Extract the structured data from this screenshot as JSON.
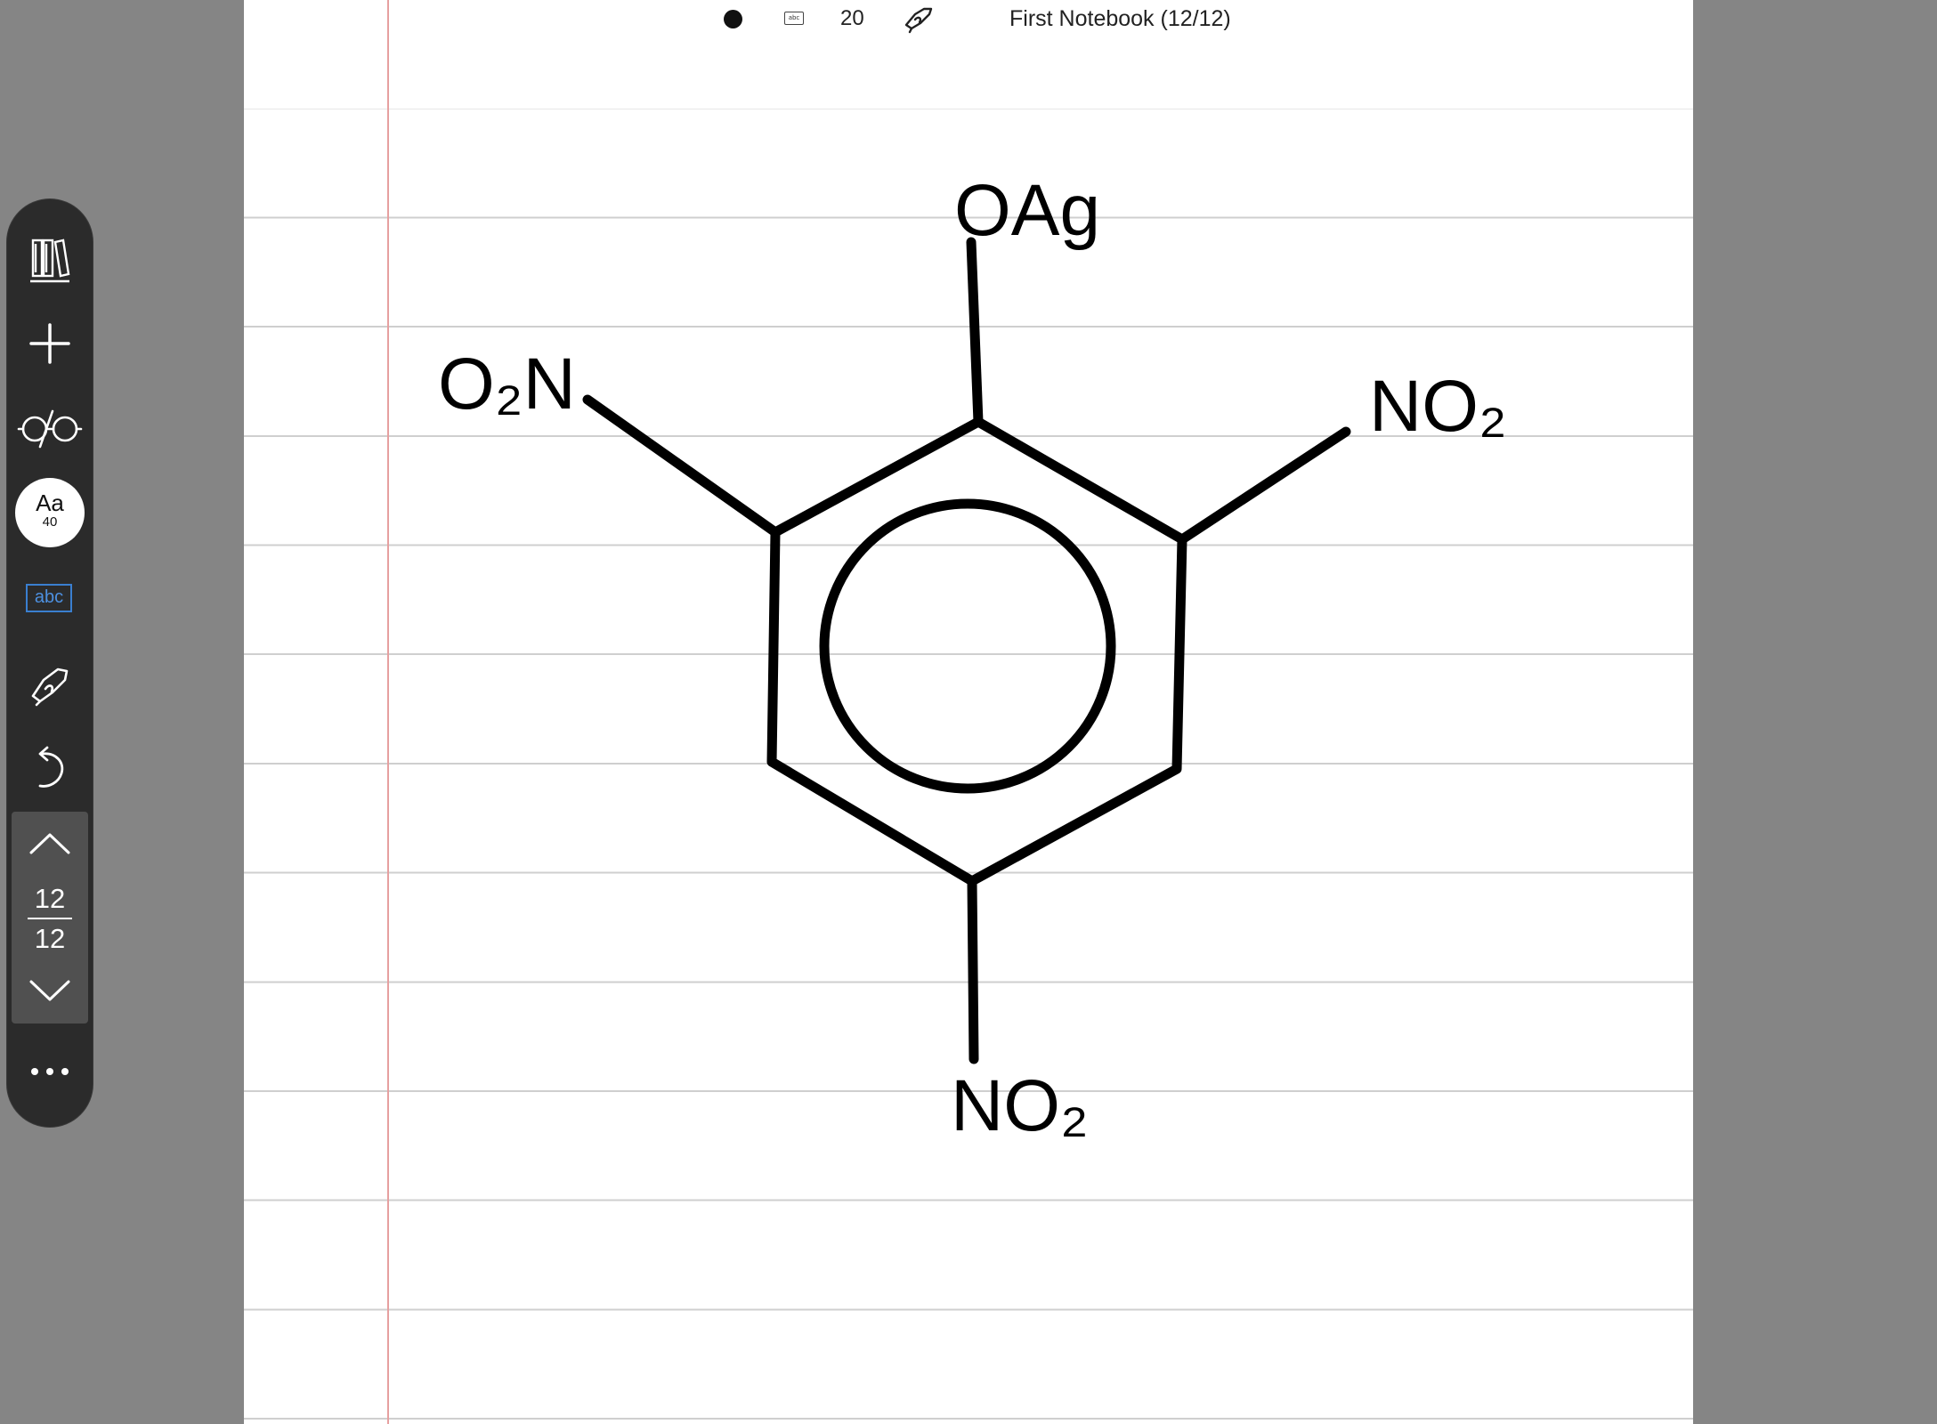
{
  "status_bar": {
    "keyboard_label": "abc",
    "stroke_count": "20",
    "notebook_title": "First Notebook (12/12)"
  },
  "toolbar": {
    "font_label": "Aa",
    "font_size": "40",
    "text_mode_label": "abc",
    "current_page": "12",
    "total_pages": "12",
    "accent_color": "#3a7fd0"
  },
  "drawing": {
    "labels": {
      "top": "OAg",
      "left": "O₂N",
      "right": "NO₂",
      "bottom": "NO₂"
    }
  },
  "colors": {
    "toolbar_bg": "#2b2b2b",
    "desk_bg": "#858585",
    "paper_bg": "#ffffff",
    "rule_line": "#cfcfcf",
    "margin_line": "#e6a0a0",
    "ink": "#000000"
  },
  "icons": {
    "library": "library-icon",
    "add": "add-page-icon",
    "view": "glasses-icon",
    "pen": "pen-icon",
    "undo": "undo-icon",
    "page_up": "chevron-up-icon",
    "page_down": "chevron-down-icon",
    "more": "more-icon"
  }
}
